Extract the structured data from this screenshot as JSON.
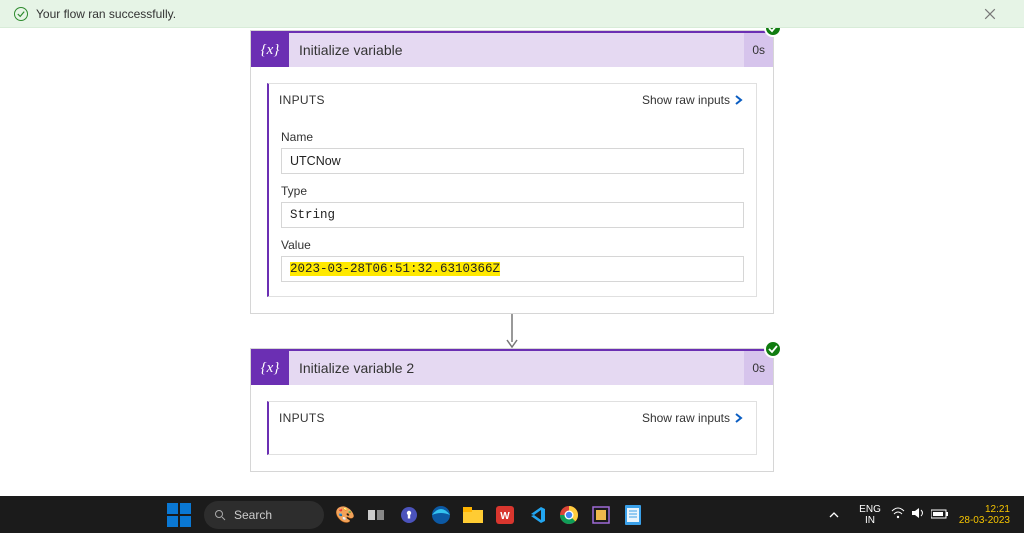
{
  "banner": {
    "message": "Your flow ran successfully."
  },
  "cards": [
    {
      "icon_glyph": "{x}",
      "title": "Initialize variable",
      "duration": "0s",
      "inputs_label": "INPUTS",
      "raw_link": "Show raw inputs",
      "fields": {
        "name_label": "Name",
        "name_value": "UTCNow",
        "type_label": "Type",
        "type_value": "String",
        "value_label": "Value",
        "value_value": "2023-03-28T06:51:32.6310366Z"
      }
    },
    {
      "icon_glyph": "{x}",
      "title": "Initialize variable 2",
      "duration": "0s",
      "inputs_label": "INPUTS",
      "raw_link": "Show raw inputs"
    }
  ],
  "taskbar": {
    "search_placeholder": "Search",
    "lang_top": "ENG",
    "lang_bottom": "IN",
    "clock_time": "12:21",
    "clock_date": "28-03-2023"
  }
}
